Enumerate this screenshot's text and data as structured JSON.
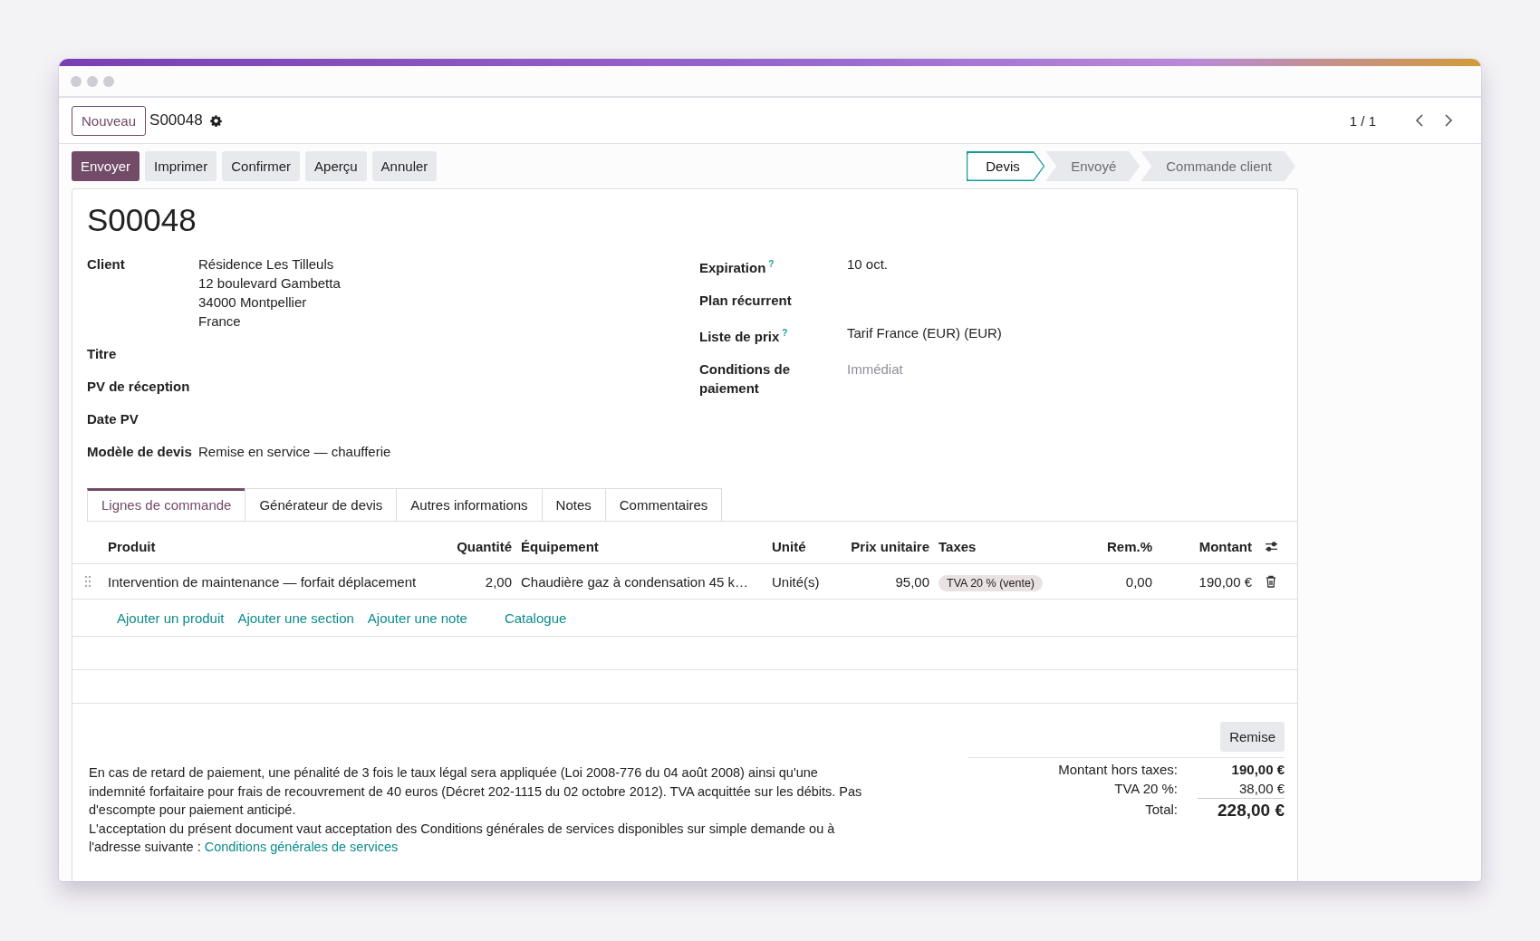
{
  "control_panel": {
    "new_button": "Nouveau",
    "record": "S00048",
    "pager": "1 / 1"
  },
  "action_buttons": [
    {
      "label": "Envoyer",
      "kind": "primary"
    },
    {
      "label": "Imprimer",
      "kind": "secondary"
    },
    {
      "label": "Confirmer",
      "kind": "secondary"
    },
    {
      "label": "Aperçu",
      "kind": "secondary"
    },
    {
      "label": "Annuler",
      "kind": "secondary"
    }
  ],
  "statusbar": [
    {
      "label": "Devis",
      "selected": true
    },
    {
      "label": "Envoyé",
      "selected": false
    },
    {
      "label": "Commande client",
      "selected": false
    }
  ],
  "title": "S00048",
  "left_fields": [
    {
      "label": "Client",
      "lines": [
        "Résidence Les Tilleuls",
        "12 boulevard Gambetta",
        "34000 Montpellier",
        "France"
      ]
    },
    {
      "label": "Titre"
    },
    {
      "label": "PV de réception"
    },
    {
      "label": "Date PV"
    },
    {
      "label": "Modèle de devis",
      "value": "Remise en service — chaufferie"
    }
  ],
  "right_fields": [
    {
      "label": "Expiration",
      "help": "?",
      "value": "10 oct."
    },
    {
      "label": "Plan récurrent"
    },
    {
      "label": "Liste de prix",
      "help": "?",
      "value": "Tarif France (EUR) (EUR)"
    },
    {
      "label": "Conditions de paiement",
      "placeholder": "Immédiat"
    }
  ],
  "tabs": [
    {
      "label": "Lignes de commande",
      "selected": true
    },
    {
      "label": "Générateur de devis",
      "selected": false
    },
    {
      "label": "Autres informations",
      "selected": false
    },
    {
      "label": "Notes",
      "selected": false
    },
    {
      "label": "Commentaires",
      "selected": false
    }
  ],
  "table": {
    "columns": [
      "Produit",
      "Quantité",
      "Équipement",
      "Unité",
      "Prix unitaire",
      "Taxes",
      "Rem.%",
      "Montant"
    ],
    "rows": [
      {
        "product": "Intervention de maintenance — forfait déplacement",
        "quantity": "2,00",
        "equipment": "Chaudière gaz à condensation 45 k…",
        "unit": "Unité(s)",
        "unit_price": "95,00",
        "taxes": [
          "TVA 20 % (vente)"
        ],
        "discount": "0,00",
        "amount": "190,00 €"
      }
    ],
    "add_links": [
      "Ajouter un produit",
      "Ajouter une section",
      "Ajouter une note"
    ],
    "catalog_link": "Catalogue"
  },
  "discount_button": "Remise",
  "note": {
    "paragraphs": [
      "En cas de retard de paiement, une pénalité de 3 fois le taux légal sera appliquée (Loi 2008-776 du 04 août 2008) ainsi qu'une indemnité forfaitaire pour frais de recouvrement de 40 euros (Décret 202-1115 du 02 octobre 2012). TVA acquittée sur les débits. Pas d'escompte pour paiement anticipé.",
      "L'acceptation du présent document vaut acceptation des Conditions générales de services disponibles sur simple demande ou à l'adresse suivante :"
    ],
    "link": "Conditions générales de services"
  },
  "totals": [
    {
      "label": "Montant hors taxes:",
      "value": "190,00 €",
      "kind": "subtotal"
    },
    {
      "label": "TVA 20 %:",
      "value": "38,00 €",
      "kind": "tax"
    },
    {
      "label": "Total:",
      "value": "228,00 €",
      "kind": "total"
    }
  ]
}
